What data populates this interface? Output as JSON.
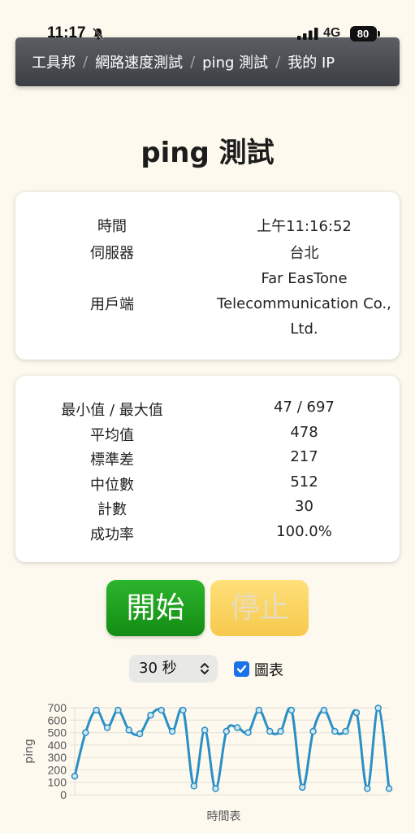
{
  "status_bar": {
    "time": "11:17",
    "network": "4G",
    "battery": "80"
  },
  "breadcrumb": [
    {
      "label": "工具邦"
    },
    {
      "label": "網路速度測試"
    },
    {
      "label": "ping 測試"
    },
    {
      "label": "我的 IP"
    }
  ],
  "page_title": "ping 測試",
  "info": {
    "time_label": "時間",
    "time_value": "上午11:16:52",
    "server_label": "伺服器",
    "server_value": "台北",
    "client_label": "用戶端",
    "client_value_lines": [
      "Far EasTone",
      "Telecommunication Co.,",
      "Ltd."
    ]
  },
  "stats": {
    "minmax_label": "最小值 / 最大值",
    "minmax_value": "47 / 697",
    "avg_label": "平均值",
    "avg_value": "478",
    "std_label": "標準差",
    "std_value": "217",
    "median_label": "中位數",
    "median_value": "512",
    "count_label": "計數",
    "count_value": "30",
    "success_label": "成功率",
    "success_value": "100.0%"
  },
  "controls": {
    "start_label": "開始",
    "stop_label": "停止",
    "duration_selected": "30 秒",
    "chart_toggle_label": "圖表",
    "chart_toggle_checked": true
  },
  "colors": {
    "start_button": "#1fa11f",
    "stop_button": "#fbd362",
    "line": "#2a8fc4",
    "checkbox": "#1a73e8"
  },
  "chart_data": {
    "type": "line",
    "xlabel": "時間表",
    "ylabel": "ping",
    "ylim": [
      0,
      700
    ],
    "yticks": [
      0,
      100,
      200,
      300,
      400,
      500,
      600,
      700
    ],
    "grid": true,
    "series": [
      {
        "values": [
          150,
          500,
          680,
          540,
          680,
          520,
          490,
          640,
          680,
          510,
          680,
          70,
          520,
          50,
          510,
          540,
          500,
          680,
          510,
          510,
          680,
          60,
          510,
          680,
          510,
          510,
          660,
          50,
          697,
          50
        ]
      }
    ]
  }
}
